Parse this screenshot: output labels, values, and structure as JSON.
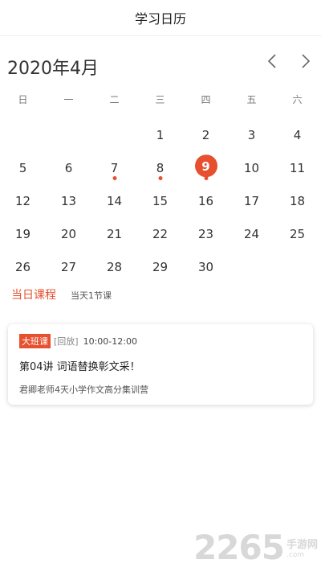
{
  "header": {
    "title": "学习日历"
  },
  "calendar": {
    "month_title": "2020年4月",
    "weekdays": [
      "日",
      "一",
      "二",
      "三",
      "四",
      "五",
      "六"
    ],
    "leading_blanks": 3,
    "days": [
      1,
      2,
      3,
      4,
      5,
      6,
      7,
      8,
      9,
      10,
      11,
      12,
      13,
      14,
      15,
      16,
      17,
      18,
      19,
      20,
      21,
      22,
      23,
      24,
      25,
      26,
      27,
      28,
      29,
      30
    ],
    "selected_day": 9,
    "days_with_classes": [
      7,
      8,
      9
    ],
    "accent_color": "#e6502e"
  },
  "section": {
    "title": "当日课程",
    "count": "当天1节课"
  },
  "course": {
    "type_tag": "大班课",
    "replay_tag": "[回放]",
    "time": "10:00-12:00",
    "lesson": "第04讲 词语替换彰文采！",
    "course_name": "君卿老师4天小学作文高分集训营"
  },
  "watermark": {
    "number": "2265",
    "cn": "手游网",
    "domain": ".com"
  },
  "icons": {
    "prev": "chevron-left-icon",
    "next": "chevron-right-icon"
  }
}
